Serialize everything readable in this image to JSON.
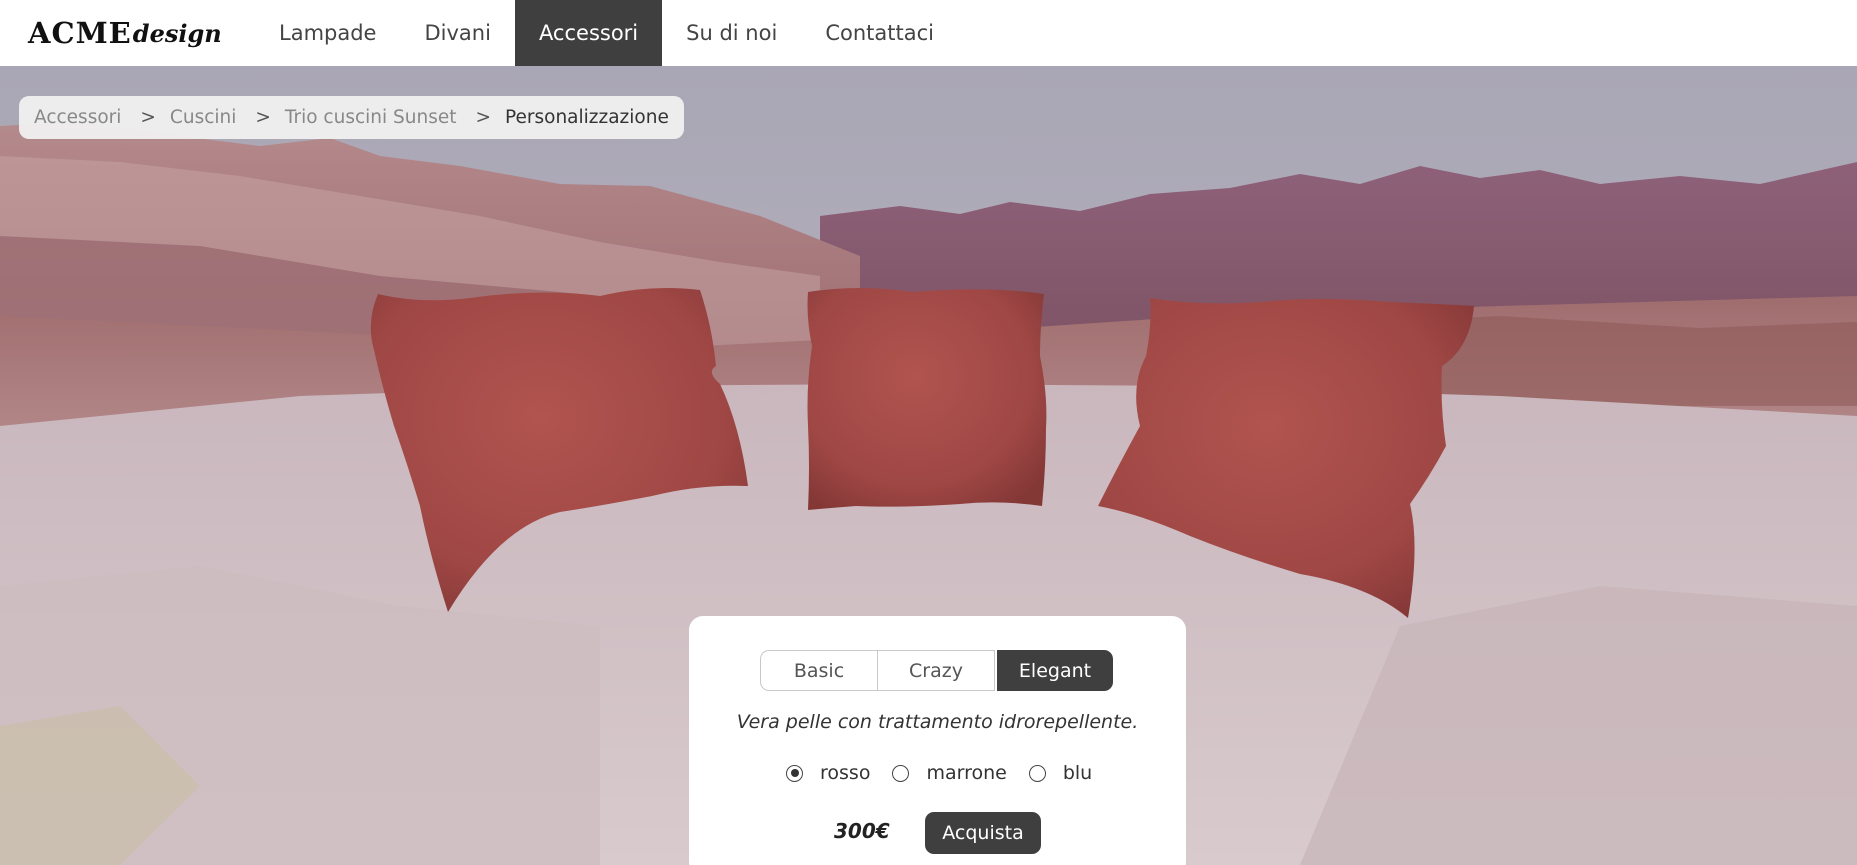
{
  "brand": {
    "logo_main": "ACME",
    "logo_suffix": "design"
  },
  "nav": {
    "items": [
      {
        "label": "Lampade"
      },
      {
        "label": "Divani"
      },
      {
        "label": "Accessori",
        "active": true
      },
      {
        "label": "Su di noi"
      },
      {
        "label": "Contattaci"
      }
    ]
  },
  "breadcrumb": {
    "items": [
      "Accessori",
      "Cuscini",
      "Trio cuscini Sunset"
    ],
    "separator": ">",
    "current": "Personalizzazione"
  },
  "configurator": {
    "tabs": [
      {
        "label": "Basic"
      },
      {
        "label": "Crazy"
      },
      {
        "label": "Elegant",
        "active": true
      }
    ],
    "description": "Vera pelle con trattamento idrorepellente.",
    "colors": [
      {
        "label": "rosso",
        "selected": true
      },
      {
        "label": "marrone",
        "selected": false
      },
      {
        "label": "blu",
        "selected": false
      }
    ],
    "price": "300€",
    "buy_label": "Acquista"
  },
  "theme": {
    "nav_active_bg": "#3f3f3f",
    "button_bg": "#3f3f3f",
    "cushion_color": "#a14a48",
    "sky_color": "#b4b0be",
    "mountain_color": "#8a5a70"
  },
  "icons": {
    "radio_selected": "radio-checked-icon",
    "radio_unselected": "radio-unchecked-icon"
  }
}
